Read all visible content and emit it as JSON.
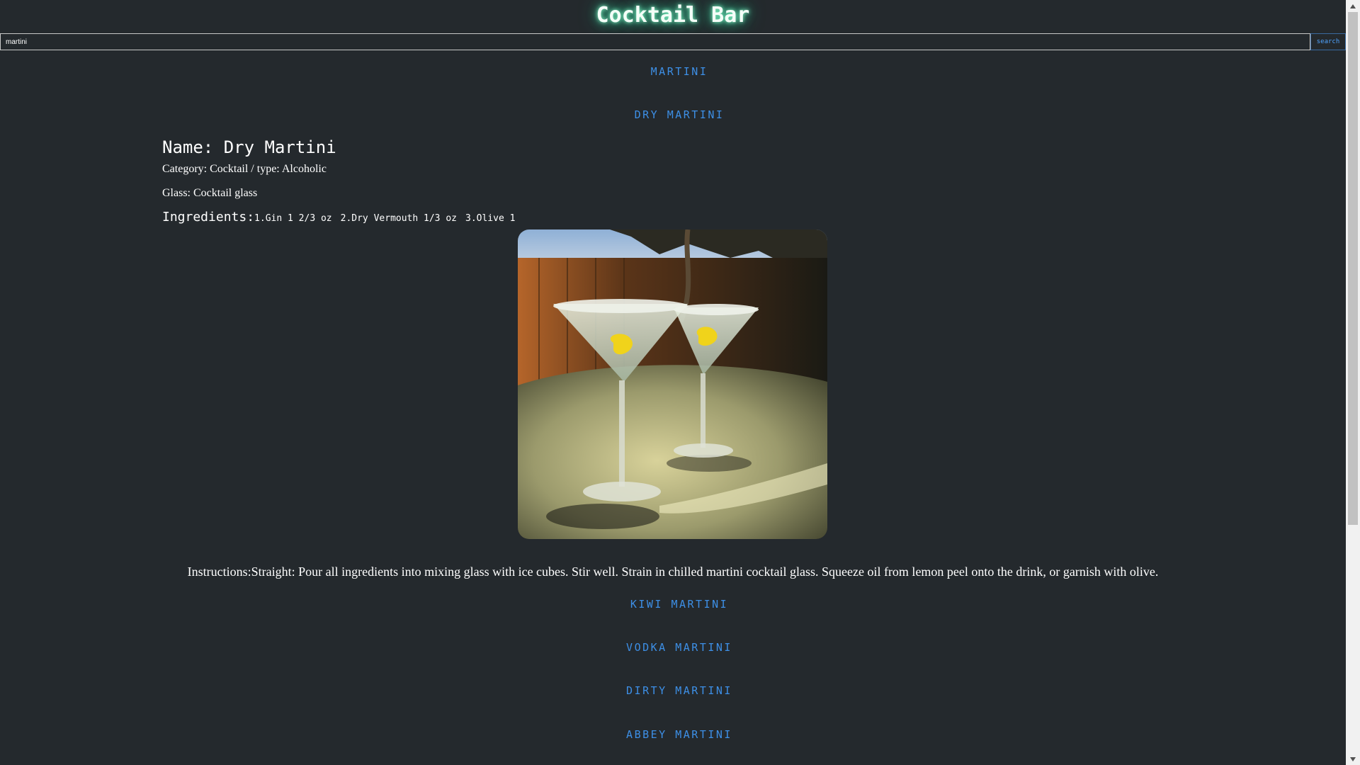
{
  "header": {
    "title": "Cocktail Bar"
  },
  "search": {
    "value": "martini",
    "button_label": "search"
  },
  "results": [
    {
      "name": "MARTINI"
    },
    {
      "name": "DRY MARTINI"
    },
    {
      "name": "KIWI MARTINI"
    },
    {
      "name": "VODKA MARTINI"
    },
    {
      "name": "DIRTY MARTINI"
    },
    {
      "name": "ABBEY MARTINI"
    }
  ],
  "detail": {
    "name": "Name: Dry Martini",
    "category": "Category: Cocktail / type: Alcoholic",
    "glass": "Glass: Cocktail glass",
    "ingredients_label": "Ingredients:",
    "ingredients": [
      "1.Gin 1 2/3 oz",
      "2.Dry Vermouth 1/3 oz",
      "3.Olive 1"
    ],
    "instructions": "Instructions:Straight: Pour all ingredients into mixing glass with ice cubes. Stir well. Strain in chilled martini cocktail glass. Squeeze oil from lemon peel onto the drink, or garnish with olive."
  },
  "colors": {
    "background": "#24292d",
    "link": "#3d8fe6",
    "title_glow": "#3fe0a5",
    "text": "#ffffff"
  },
  "icons": {
    "scroll_up": "triangle-up-icon",
    "scroll_down": "triangle-down-icon"
  }
}
